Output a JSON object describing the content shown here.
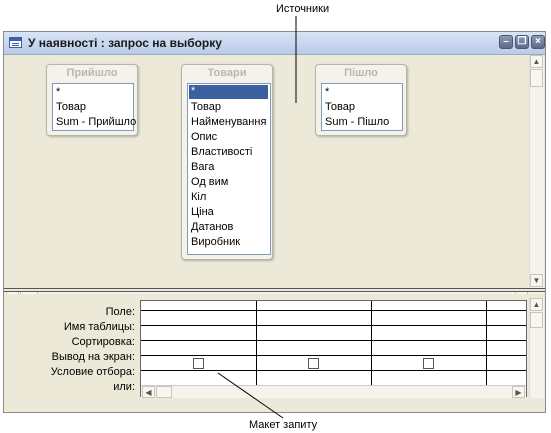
{
  "callouts": {
    "sources": "Источники",
    "layout": "Макет запиту"
  },
  "window": {
    "title": "У наявності : запрос на выборку"
  },
  "field_lists": [
    {
      "title": "Прийшло",
      "items": [
        "*",
        "Товар",
        "Sum - Прийшло"
      ]
    },
    {
      "title": "Товари",
      "items": [
        "*",
        "Товар",
        "Найменування",
        "Опис",
        "Властивості",
        "Вага",
        "Од вим",
        "Кіл",
        "Ціна",
        "Датанов",
        "Виробник"
      ]
    },
    {
      "title": "Пішло",
      "items": [
        "*",
        "Товар",
        "Sum - Пішло"
      ]
    }
  ],
  "grid": {
    "row_labels": [
      "Поле:",
      "Имя таблицы:",
      "Сортировка:",
      "Вывод на экран:",
      "Условие отбора:",
      "или:"
    ]
  }
}
